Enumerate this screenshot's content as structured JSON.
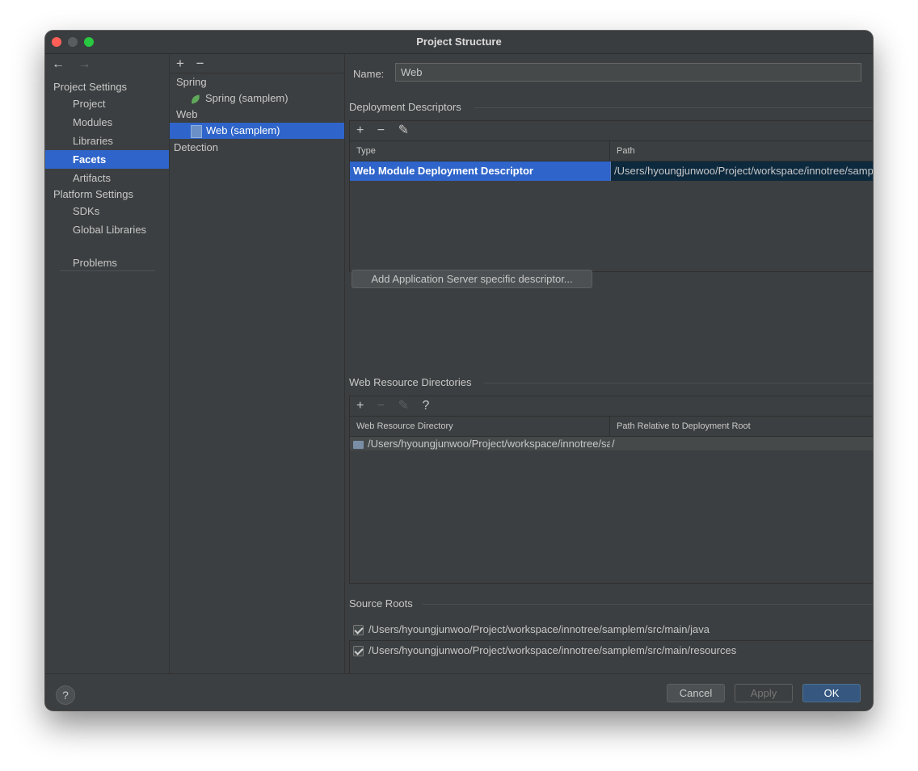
{
  "window": {
    "title": "Project Structure"
  },
  "nav": {
    "back": "←",
    "forward": "→",
    "project_settings": "Project Settings",
    "project": "Project",
    "modules": "Modules",
    "libraries": "Libraries",
    "facets": "Facets",
    "artifacts": "Artifacts",
    "platform_settings": "Platform Settings",
    "sdks": "SDKs",
    "global_libraries": "Global Libraries",
    "problems": "Problems"
  },
  "tree": {
    "add": "+",
    "remove": "−",
    "spring_group": "Spring",
    "spring_item": "Spring (samplem)",
    "web_group": "Web",
    "web_item": "Web (samplem)",
    "detection": "Detection"
  },
  "main": {
    "name_label": "Name:",
    "name_value": "Web",
    "deployment_title": "Deployment Descriptors",
    "dd_tools": {
      "add": "+",
      "remove": "−",
      "edit": "✎"
    },
    "dd_columns": {
      "type": "Type",
      "path": "Path"
    },
    "dd_row": {
      "type": "Web Module Deployment Descriptor",
      "path": "/Users/hyoungjunwoo/Project/workspace/innotree/samplem/src/main/webapp/WEB-INF/web.xml"
    },
    "add_server_descriptor": "Add Application Server specific descriptor...",
    "web_resource_title": "Web Resource Directories",
    "wr_tools": {
      "add": "+",
      "remove": "−",
      "edit": "✎",
      "help": "?"
    },
    "wr_columns": {
      "dir": "Web Resource Directory",
      "rel": "Path Relative to Deployment Root"
    },
    "wr_row": {
      "dir": "/Users/hyoungjunwoo/Project/workspace/innotree/samplem/src/main/webapp",
      "rel": "/"
    },
    "source_roots_title": "Source Roots",
    "source_roots": [
      "/Users/hyoungjunwoo/Project/workspace/innotree/samplem/src/main/java",
      "/Users/hyoungjunwoo/Project/workspace/innotree/samplem/src/main/resources"
    ]
  },
  "footer": {
    "help": "?",
    "cancel": "Cancel",
    "apply": "Apply",
    "ok": "OK"
  },
  "colors": {
    "selection": "#2f65ca",
    "background": "#3c3f41",
    "ok_button": "#365880"
  }
}
